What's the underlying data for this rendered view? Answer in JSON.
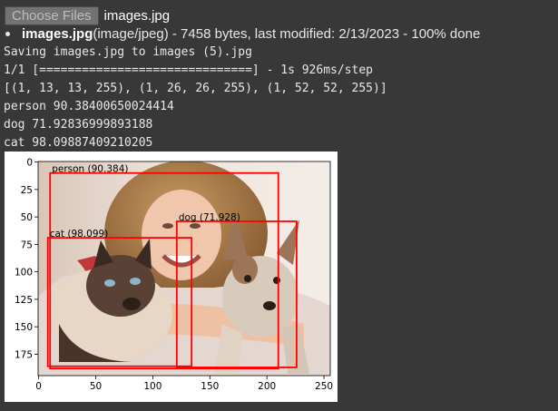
{
  "upload": {
    "button_label": "Choose Files",
    "selected_file": "images.jpg"
  },
  "file_info": {
    "name": "images.jpg",
    "details": "(image/jpeg) - 7458 bytes, last modified: 2/13/2023 - 100% done"
  },
  "output_lines": [
    "Saving images.jpg to images (5).jpg",
    "1/1 [==============================] - 1s 926ms/step",
    "[(1, 13, 13, 255), (1, 26, 26, 255), (1, 52, 52, 255)]",
    "person 90.38400650024414",
    "dog 71.92836999893188",
    "cat 98.09887409210205"
  ],
  "chart_data": {
    "type": "image-with-detections",
    "xlim": [
      -0.5,
      255.5
    ],
    "ylim": [
      194.5,
      -0.5
    ],
    "x_ticks": [
      0,
      50,
      100,
      150,
      200,
      250
    ],
    "y_ticks": [
      0,
      25,
      50,
      75,
      100,
      125,
      150,
      175
    ],
    "box_color": "#ff0000",
    "detections": [
      {
        "label": "person (90.384)",
        "x1": 10,
        "y1": 10,
        "x2": 210,
        "y2": 188
      },
      {
        "label": "dog (71.928)",
        "x1": 121,
        "y1": 54,
        "x2": 226,
        "y2": 187
      },
      {
        "label": "cat (98.099)",
        "x1": 8,
        "y1": 69,
        "x2": 134,
        "y2": 186
      }
    ]
  }
}
